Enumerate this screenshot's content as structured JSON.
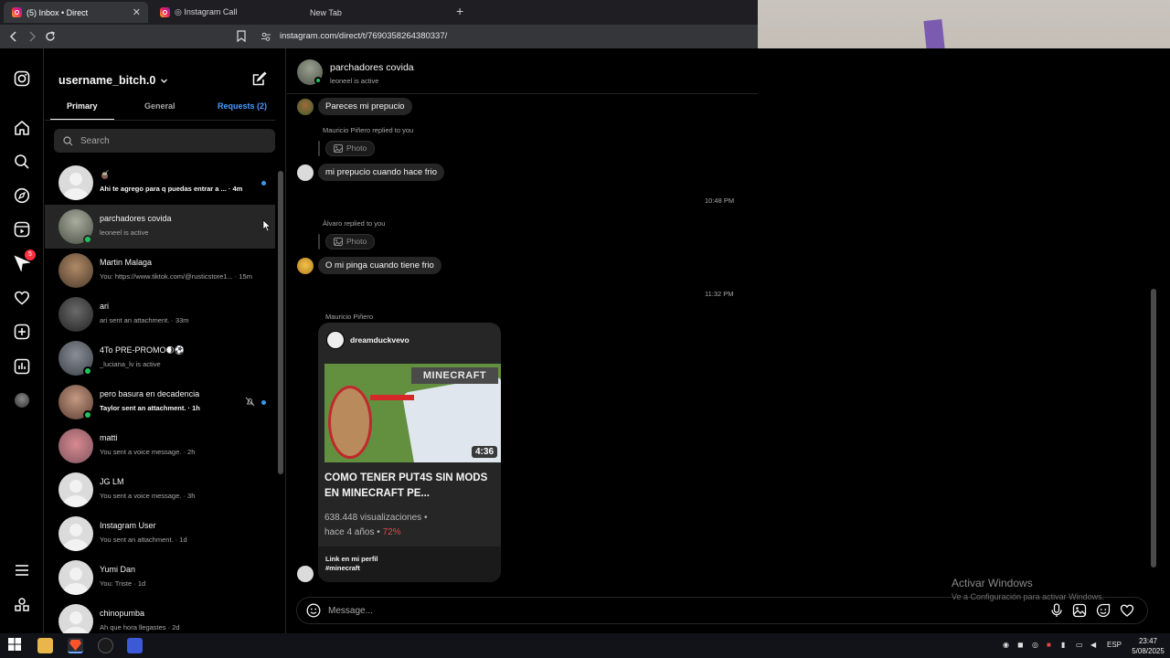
{
  "browser": {
    "tabs": [
      {
        "label": "(5) Inbox • Direct",
        "active": true
      },
      {
        "label": "◎ Instagram Call",
        "active": false
      },
      {
        "label": "New Tab",
        "active": false
      }
    ],
    "url": "instagram.com/direct/t/7690358264380337/"
  },
  "inbox": {
    "username": "username_bitch.0",
    "tabs": {
      "primary": "Primary",
      "general": "General",
      "requests": "Requests (2)"
    },
    "search_placeholder": "Search",
    "nav_badge": "5",
    "conversations": [
      {
        "name": "🧉",
        "sub": "Ahi te agrego para q puedas entrar a ... · 4m",
        "unread": true,
        "bold": true,
        "online": false
      },
      {
        "name": "parchadores covida",
        "sub": "leoneel is active",
        "unread": false,
        "bold": false,
        "online": true,
        "selected": true
      },
      {
        "name": "Martin Malaga",
        "sub": "You: https://www.tiktok.com/@rusticstore1... · 15m",
        "unread": false,
        "bold": false,
        "online": false
      },
      {
        "name": "ari",
        "sub": "ari sent an attachment. · 33m",
        "unread": false,
        "bold": false,
        "online": false
      },
      {
        "name": "4To PRE-PROMO🌒⚽",
        "sub": "_luciana_lv is active",
        "unread": false,
        "bold": false,
        "online": true
      },
      {
        "name": "pero basura en decadencia",
        "sub": "Taylor sent an attachment. · 1h",
        "unread": true,
        "bold": true,
        "online": true,
        "muted": true
      },
      {
        "name": "matti",
        "sub": "You sent a voice message. · 2h",
        "unread": false,
        "bold": false,
        "online": false
      },
      {
        "name": "JG LM",
        "sub": "You sent a voice message. · 3h",
        "unread": false,
        "bold": false,
        "online": false
      },
      {
        "name": "Instagram User",
        "sub": "You sent an attachment. · 1d",
        "unread": false,
        "bold": false,
        "online": false
      },
      {
        "name": "Yumi Dan",
        "sub": "You: Triste · 1d",
        "unread": false,
        "bold": false,
        "online": false
      },
      {
        "name": "chinopumba",
        "sub": "Ah que hora llegastes · 2d",
        "unread": false,
        "bold": false,
        "online": false
      }
    ]
  },
  "chat": {
    "title": "parchadores covida",
    "status": "leoneel is active",
    "messages": {
      "m1": "Pareces mi prepucio",
      "reply1": "Mauricio Piñero replied to you",
      "photo_label": "Photo",
      "m2": "mi prepucio cuando hace frio",
      "time1": "10:48 PM",
      "reply2": "Álvaro replied to you",
      "m3": "O mi pinga cuando tiene frio",
      "time2": "11:32 PM",
      "sender3": "Mauricio Piñero"
    },
    "share": {
      "owner": "dreamduckvevo",
      "thumb_text": "MINECRAFT",
      "duration": "4:36",
      "title": "COMO TENER PUT4S SIN MODS EN MINECRAFT PE...",
      "views": "638.448 visualizaciones •",
      "age": "hace 4 años •",
      "percent": "72%",
      "caption1": "Link en mi perfil",
      "caption2": "#minecraft"
    },
    "composer_placeholder": "Message..."
  },
  "windows": {
    "activate_title": "Activar Windows",
    "activate_sub": "Ve a Configuración para activar Windows.",
    "lang": "ESP",
    "time": "23:47",
    "date": "5/08/2025"
  }
}
